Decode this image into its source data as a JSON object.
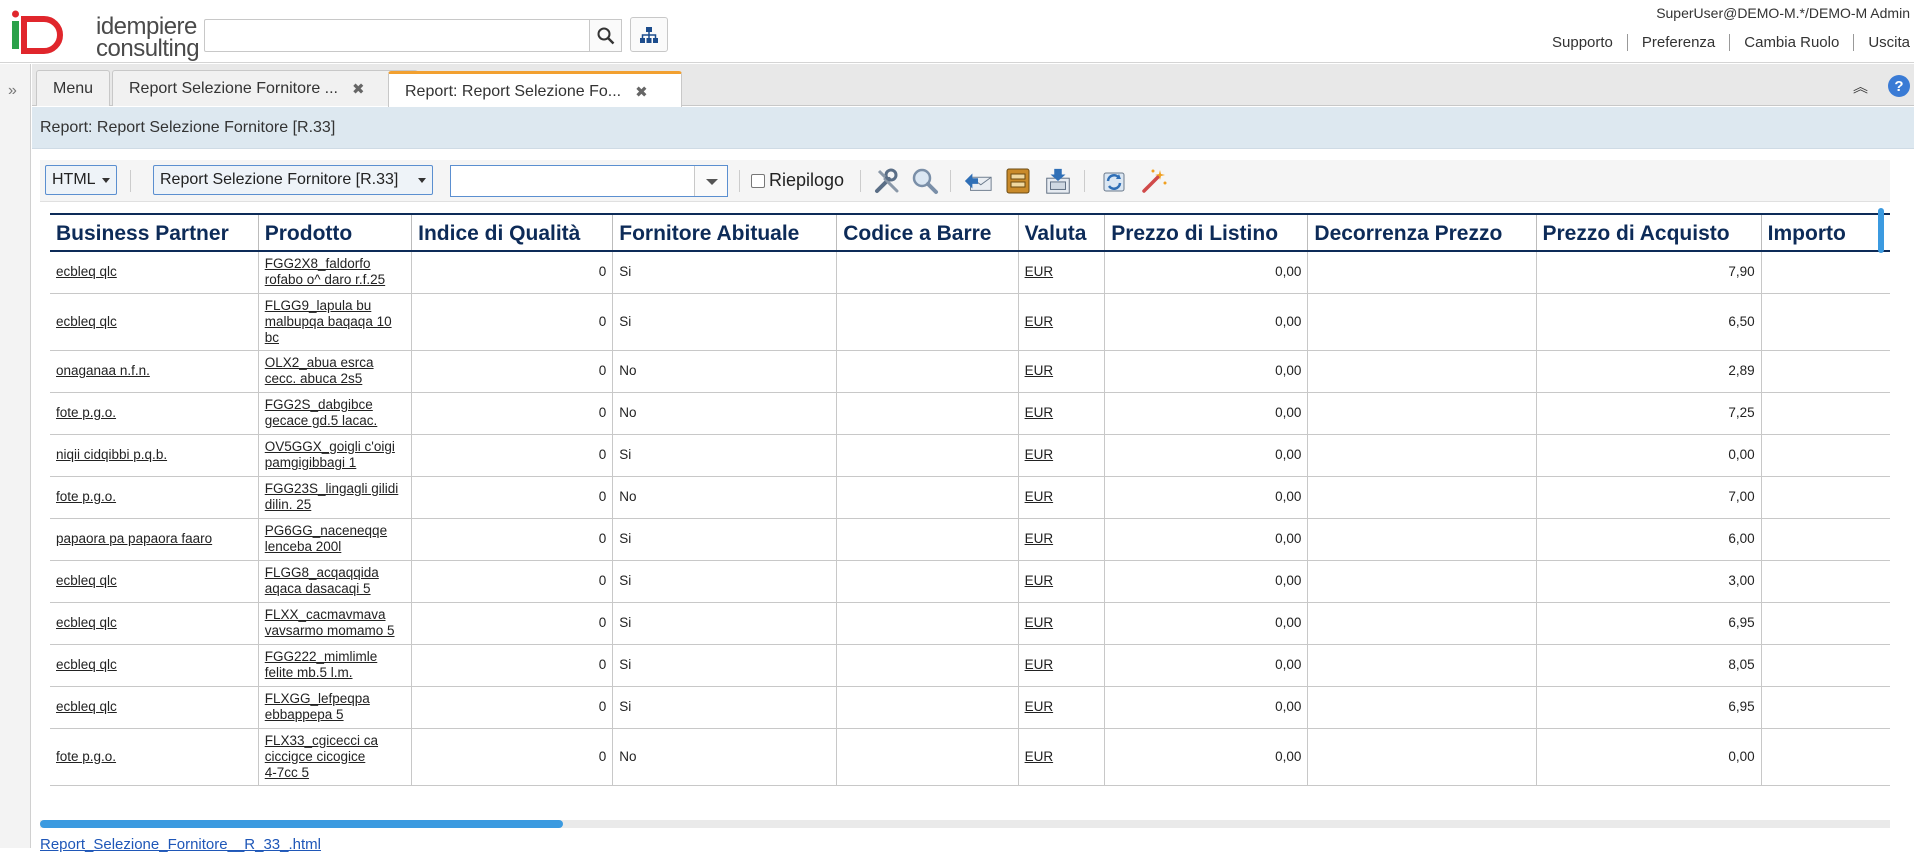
{
  "header": {
    "user": "SuperUser@DEMO-M.*/DEMO-M Admin",
    "logo_line1": "idempiere",
    "logo_line2": "consulting",
    "search_placeholder": "",
    "links": [
      "Supporto",
      "Preferenza",
      "Cambia Ruolo",
      "Uscita"
    ]
  },
  "tabs": [
    {
      "label": "Menu"
    },
    {
      "label": "Report Selezione Fornitore ..."
    },
    {
      "label": "Report: Report Selezione Fo..."
    }
  ],
  "title": "Report: Report Selezione Fornitore [R.33]",
  "toolbar": {
    "format": "HTML",
    "report_select": "Report Selezione Fornitore [R.33]",
    "combo_value": "",
    "summary_label": "Riepilogo"
  },
  "table": {
    "columns": [
      "Business Partner",
      "Prodotto",
      "Indice di Qualità",
      "Fornitore Abituale",
      "Codice a Barre",
      "Valuta",
      "Prezzo di Listino",
      "Decorrenza Prezzo",
      "Prezzo di Acquisto",
      "Importo"
    ],
    "rows": [
      {
        "bp": "ecbleq qlc",
        "prod": [
          "FGG2X8_faldorfo",
          "rofabo o^ daro r.f.25"
        ],
        "quality": "0",
        "habitual": "Si",
        "barcode": "",
        "currency": "EUR",
        "list_price": "0,00",
        "date": "",
        "purchase": "7,90",
        "amount": ""
      },
      {
        "bp": "ecbleq qlc",
        "prod": [
          "FLGG9_lapula bu",
          "malbupqa baqaqa 10",
          "bc"
        ],
        "quality": "0",
        "habitual": "Si",
        "barcode": "",
        "currency": "EUR",
        "list_price": "0,00",
        "date": "",
        "purchase": "6,50",
        "amount": ""
      },
      {
        "bp": "onaganaa n.f.n.",
        "prod": [
          "OLX2_abua esrca",
          "cecc. abuca 2s5"
        ],
        "quality": "0",
        "habitual": "No",
        "barcode": "",
        "currency": "EUR",
        "list_price": "0,00",
        "date": "",
        "purchase": "2,89",
        "amount": ""
      },
      {
        "bp": "fote p.g.o.",
        "prod": [
          "FGG2S_dabgibce",
          "gecace gd.5 lacac."
        ],
        "quality": "0",
        "habitual": "No",
        "barcode": "",
        "currency": "EUR",
        "list_price": "0,00",
        "date": "",
        "purchase": "7,25",
        "amount": ""
      },
      {
        "bp": "niqii cidqibbi p.q.b.",
        "prod": [
          "OV5GGX_goigli c'oigi",
          "pamgigibbagi 1"
        ],
        "quality": "0",
        "habitual": "Si",
        "barcode": "",
        "currency": "EUR",
        "list_price": "0,00",
        "date": "",
        "purchase": "0,00",
        "amount": ""
      },
      {
        "bp": "fote p.g.o.",
        "prod": [
          "FGG23S_lingagli gilidi",
          "dilin. 25"
        ],
        "quality": "0",
        "habitual": "No",
        "barcode": "",
        "currency": "EUR",
        "list_price": "0,00",
        "date": "",
        "purchase": "7,00",
        "amount": ""
      },
      {
        "bp": "papaora pa papaora faaro",
        "prod": [
          "PG6GG_naceneqqe",
          "lenceba 200l"
        ],
        "quality": "0",
        "habitual": "Si",
        "barcode": "",
        "currency": "EUR",
        "list_price": "0,00",
        "date": "",
        "purchase": "6,00",
        "amount": ""
      },
      {
        "bp": "ecbleq qlc",
        "prod": [
          "FLGG8_acqaqqida",
          "aqaca dasacaqi 5"
        ],
        "quality": "0",
        "habitual": "Si",
        "barcode": "",
        "currency": "EUR",
        "list_price": "0,00",
        "date": "",
        "purchase": "3,00",
        "amount": ""
      },
      {
        "bp": "ecbleq qlc",
        "prod": [
          "FLXX_cacmavmava",
          "vavsarmo momamo 5"
        ],
        "quality": "0",
        "habitual": "Si",
        "barcode": "",
        "currency": "EUR",
        "list_price": "0,00",
        "date": "",
        "purchase": "6,95",
        "amount": ""
      },
      {
        "bp": "ecbleq qlc",
        "prod": [
          "FGG222_mimlimle",
          "felite mb.5 l.m."
        ],
        "quality": "0",
        "habitual": "Si",
        "barcode": "",
        "currency": "EUR",
        "list_price": "0,00",
        "date": "",
        "purchase": "8,05",
        "amount": ""
      },
      {
        "bp": "ecbleq qlc",
        "prod": [
          "FLXGG_lefpeqpa",
          "ebbappepa 5"
        ],
        "quality": "0",
        "habitual": "Si",
        "barcode": "",
        "currency": "EUR",
        "list_price": "0,00",
        "date": "",
        "purchase": "6,95",
        "amount": ""
      },
      {
        "bp": "fote p.g.o.",
        "prod": [
          "FLX33_cgicecci ca",
          "ciccigce cicogice",
          "4-7cc 5"
        ],
        "quality": "0",
        "habitual": "No",
        "barcode": "",
        "currency": "EUR",
        "list_price": "0,00",
        "date": "",
        "purchase": "0,00",
        "amount": ""
      }
    ]
  },
  "bottom_link": "Report_Selezione_Fornitore__R_33_.html",
  "colors": {
    "accent_tab": "#f2a030",
    "header_text": "#0d2b58",
    "titlebar_bg": "#dde8f0",
    "link_blue": "#1f57b8"
  }
}
